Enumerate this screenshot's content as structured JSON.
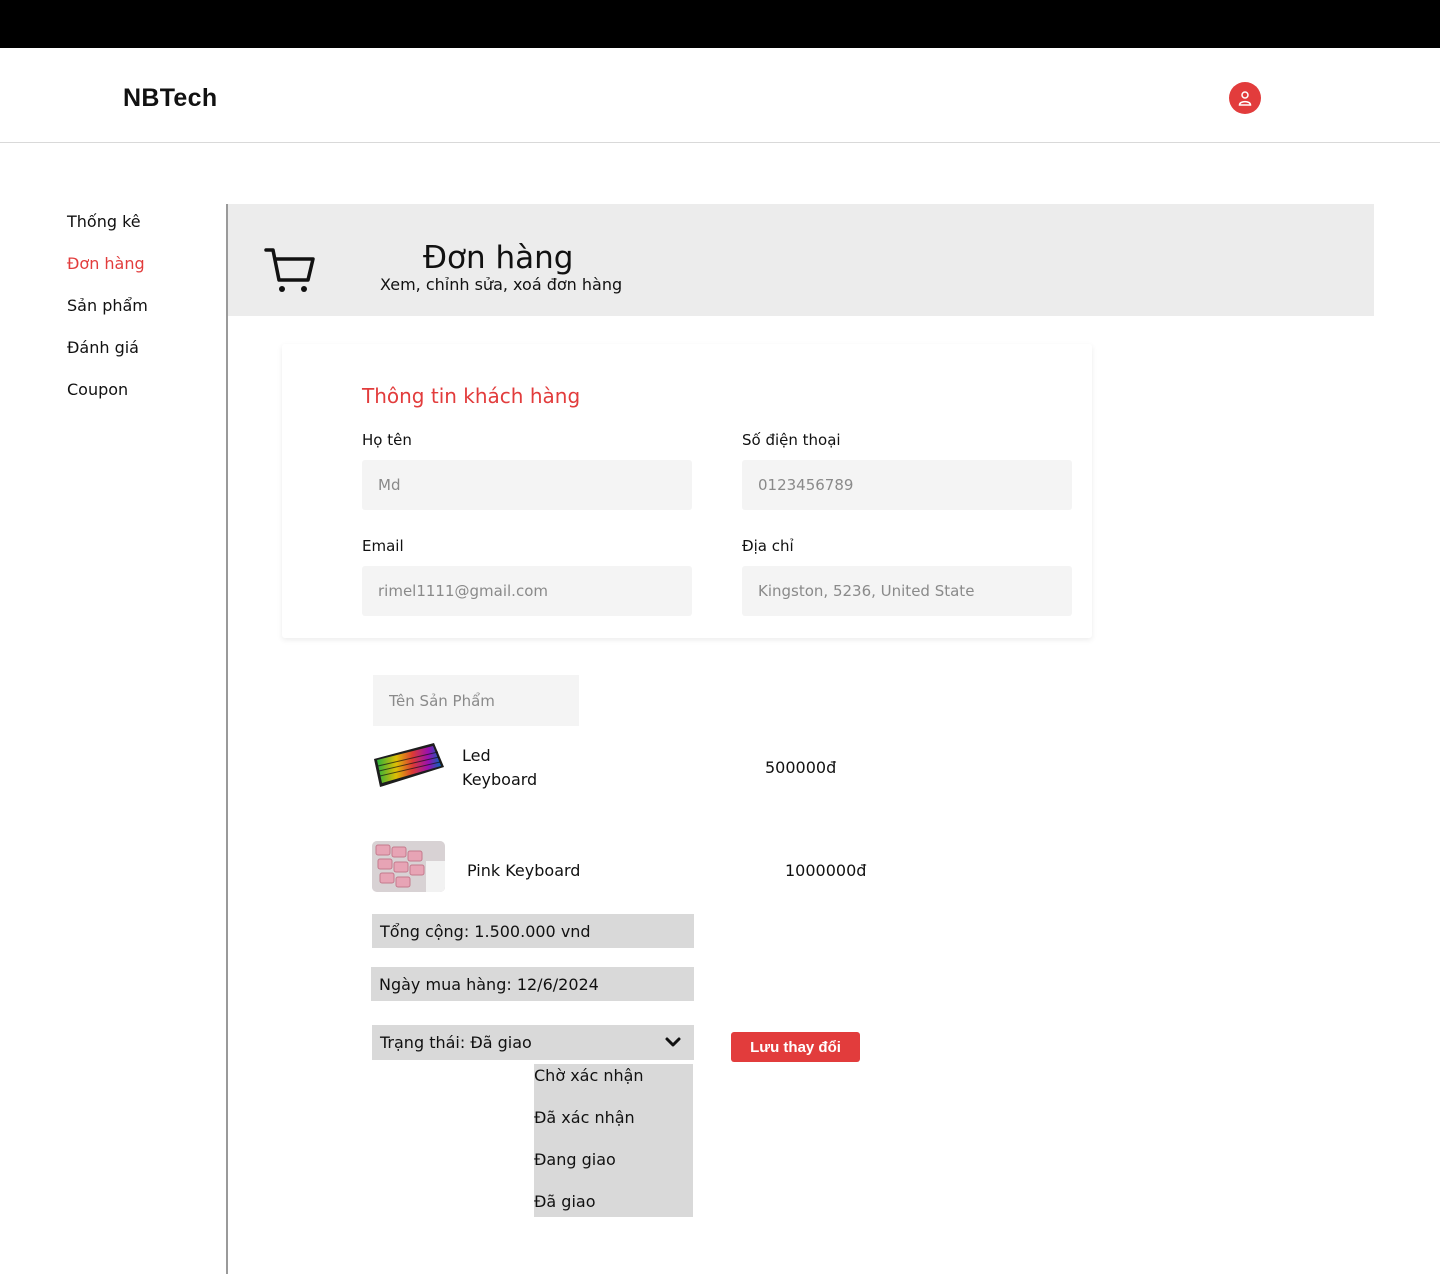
{
  "app": {
    "brand": "NBTech"
  },
  "header": {
    "avatar_icon": "user-icon",
    "avatar_color": "#e23c3c"
  },
  "sidebar": {
    "items": [
      {
        "label": "Thống kê",
        "active": false
      },
      {
        "label": "Đơn hàng",
        "active": true
      },
      {
        "label": "Sản phẩm",
        "active": false
      },
      {
        "label": "Đánh giá",
        "active": false
      },
      {
        "label": "Coupon",
        "active": false
      }
    ]
  },
  "banner": {
    "icon": "cart-icon",
    "title": "Đơn hàng",
    "subtitle": "Xem, chỉnh sửa, xoá đơn hàng"
  },
  "customer": {
    "title": "Thông tin  khách hàng",
    "fields": {
      "name": {
        "label": "Họ tên",
        "value": "Md"
      },
      "phone": {
        "label": "Số điện thoại",
        "value": "0123456789"
      },
      "email": {
        "label": "Email",
        "value": "rimel1111@gmail.com"
      },
      "address": {
        "label": "Địa chỉ",
        "value": "Kingston, 5236, United State"
      }
    }
  },
  "products": {
    "search_placeholder": "Tên Sản Phẩm",
    "items": [
      {
        "name": "Led Keyboard",
        "price": "500000đ"
      },
      {
        "name": "Pink Keyboard",
        "price": "1000000đ"
      }
    ]
  },
  "order": {
    "total": "Tổng cộng: 1.500.000 vnd",
    "date": "Ngày mua hàng: 12/6/2024",
    "status": "Trạng thái: Đã giao",
    "status_options": [
      "Chờ xác nhận",
      "Đã xác nhận",
      "Đang giao",
      "Đã giao"
    ],
    "save_label": "Lưu thay đổi"
  },
  "colors": {
    "accent": "#e23c3c",
    "banner_bg": "#ececec",
    "input_bg": "#f4f4f4",
    "bar_bg": "#d9d9d9"
  }
}
